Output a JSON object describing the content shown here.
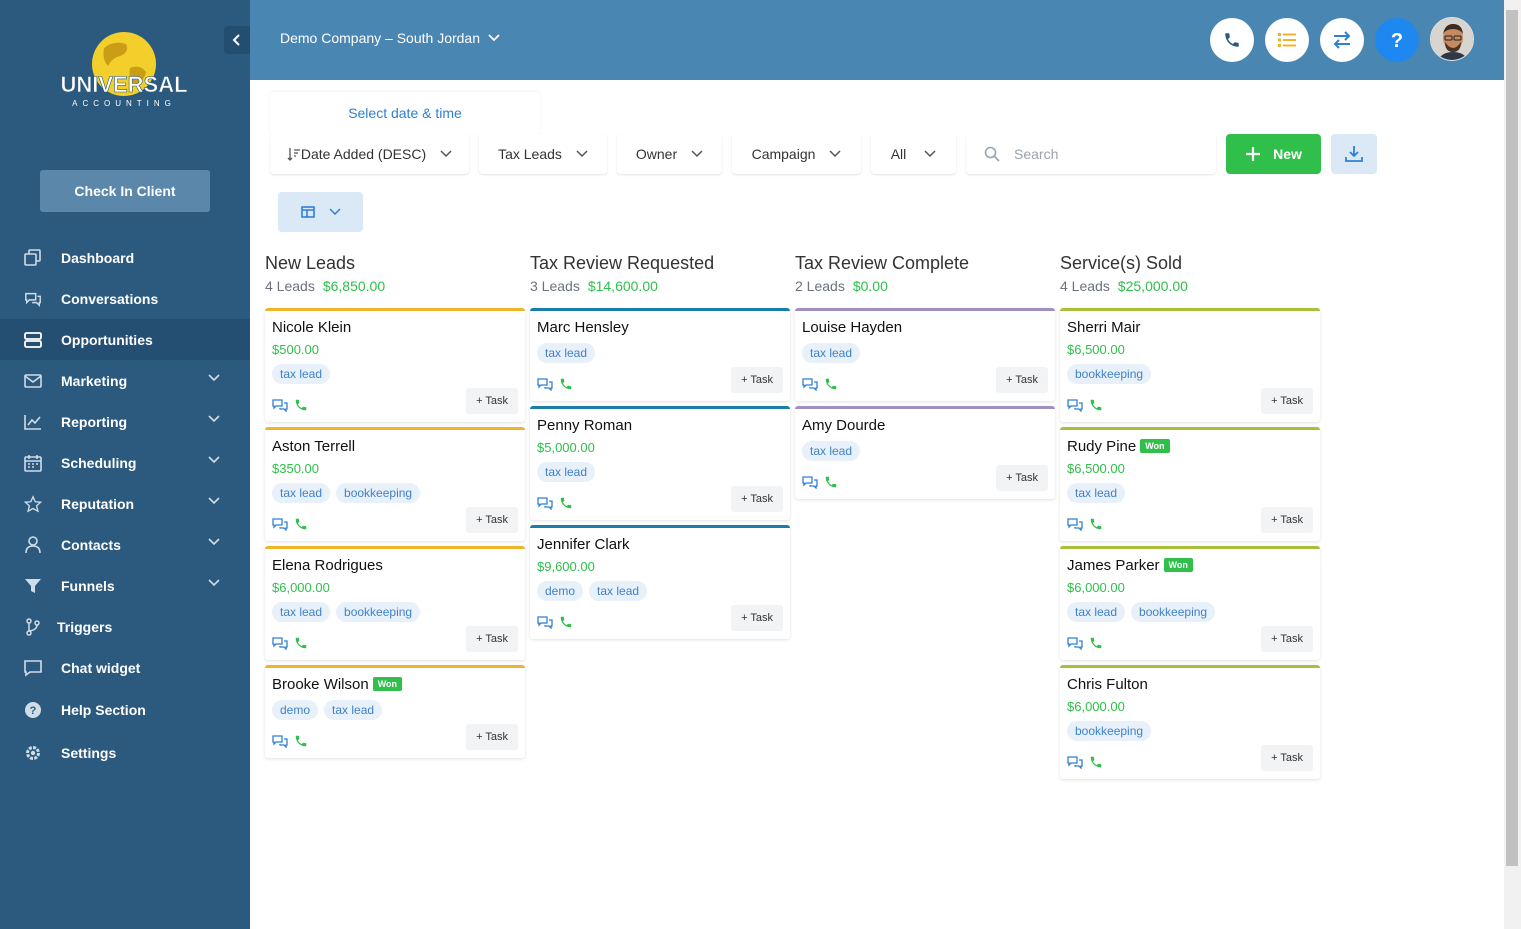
{
  "brand": {
    "logo_text": "UNIVERSAL",
    "logo_sub": "ACCOUNTING"
  },
  "sidebar": {
    "check_in": "Check In Client",
    "items": [
      {
        "label": "Dashboard",
        "icon": "dashboard-icon",
        "has_chevron": false,
        "active": false
      },
      {
        "label": "Conversations",
        "icon": "chat-icon",
        "has_chevron": false,
        "active": false
      },
      {
        "label": "Opportunities",
        "icon": "stack-icon",
        "has_chevron": false,
        "active": true
      },
      {
        "label": "Marketing",
        "icon": "mail-icon",
        "has_chevron": true,
        "active": false
      },
      {
        "label": "Reporting",
        "icon": "chart-icon",
        "has_chevron": true,
        "active": false
      },
      {
        "label": "Scheduling",
        "icon": "calendar-icon",
        "has_chevron": true,
        "active": false
      },
      {
        "label": "Reputation",
        "icon": "star-icon",
        "has_chevron": true,
        "active": false
      },
      {
        "label": "Contacts",
        "icon": "user-icon",
        "has_chevron": true,
        "active": false
      },
      {
        "label": "Funnels",
        "icon": "filter-icon",
        "has_chevron": true,
        "active": false
      },
      {
        "label": "Triggers",
        "icon": "branch-icon",
        "has_chevron": false,
        "active": false
      },
      {
        "label": "Chat widget",
        "icon": "chat-bubble-icon",
        "has_chevron": false,
        "active": false
      },
      {
        "label": "Help Section",
        "icon": "help-icon",
        "has_chevron": false,
        "active": false
      },
      {
        "label": "Settings",
        "icon": "gear-icon",
        "has_chevron": false,
        "active": false
      }
    ]
  },
  "header": {
    "company": "Demo Company – South Jordan"
  },
  "filters": {
    "date_tab": "Select date & time",
    "sort": "Date Added (DESC)",
    "pipeline": "Tax Leads",
    "owner": "Owner",
    "campaign": "Campaign",
    "status": "All",
    "search_placeholder": "Search",
    "new_label": "New"
  },
  "colors": {
    "accent": "#2f80d3",
    "success": "#2fbf4a",
    "new_leads": "#f0b429",
    "tax_review_requested": "#1a7fa8",
    "tax_review_complete": "#a18fbf",
    "services_sold": "#a9bf3a"
  },
  "task_label": "+ Task",
  "won_label": "Won",
  "columns": [
    {
      "title": "New Leads",
      "count": "4 Leads",
      "amount": "$6,850.00",
      "color": "#f0b429",
      "cards": [
        {
          "name": "Nicole Klein",
          "value": "$500.00",
          "won": false,
          "tags": [
            "tax lead"
          ]
        },
        {
          "name": "Aston Terrell",
          "value": "$350.00",
          "won": false,
          "tags": [
            "tax lead",
            "bookkeeping"
          ]
        },
        {
          "name": "Elena Rodrigues",
          "value": "$6,000.00",
          "won": false,
          "tags": [
            "tax lead",
            "bookkeeping"
          ]
        },
        {
          "name": "Brooke Wilson",
          "value": "",
          "won": true,
          "tags": [
            "demo",
            "tax lead"
          ]
        }
      ]
    },
    {
      "title": "Tax Review Requested",
      "count": "3 Leads",
      "amount": "$14,600.00",
      "color": "#1a7fa8",
      "cards": [
        {
          "name": "Marc Hensley",
          "value": "",
          "won": false,
          "tags": [
            "tax lead"
          ]
        },
        {
          "name": "Penny Roman",
          "value": "$5,000.00",
          "won": false,
          "tags": [
            "tax lead"
          ]
        },
        {
          "name": "Jennifer Clark",
          "value": "$9,600.00",
          "won": false,
          "tags": [
            "demo",
            "tax lead"
          ]
        }
      ]
    },
    {
      "title": "Tax Review Complete",
      "count": "2 Leads",
      "amount": "$0.00",
      "color": "#a18fbf",
      "cards": [
        {
          "name": "Louise Hayden",
          "value": "",
          "won": false,
          "tags": [
            "tax lead"
          ]
        },
        {
          "name": "Amy Dourde",
          "value": "",
          "won": false,
          "tags": [
            "tax lead"
          ]
        }
      ]
    },
    {
      "title": "Service(s) Sold",
      "count": "4 Leads",
      "amount": "$25,000.00",
      "color": "#a9bf3a",
      "cards": [
        {
          "name": "Sherri Mair",
          "value": "$6,500.00",
          "won": false,
          "tags": [
            "bookkeeping"
          ]
        },
        {
          "name": "Rudy Pine",
          "value": "$6,500.00",
          "won": true,
          "tags": [
            "tax lead"
          ]
        },
        {
          "name": "James Parker",
          "value": "$6,000.00",
          "won": true,
          "tags": [
            "tax lead",
            "bookkeeping"
          ]
        },
        {
          "name": "Chris Fulton",
          "value": "$6,000.00",
          "won": false,
          "tags": [
            "bookkeeping"
          ]
        }
      ]
    }
  ]
}
